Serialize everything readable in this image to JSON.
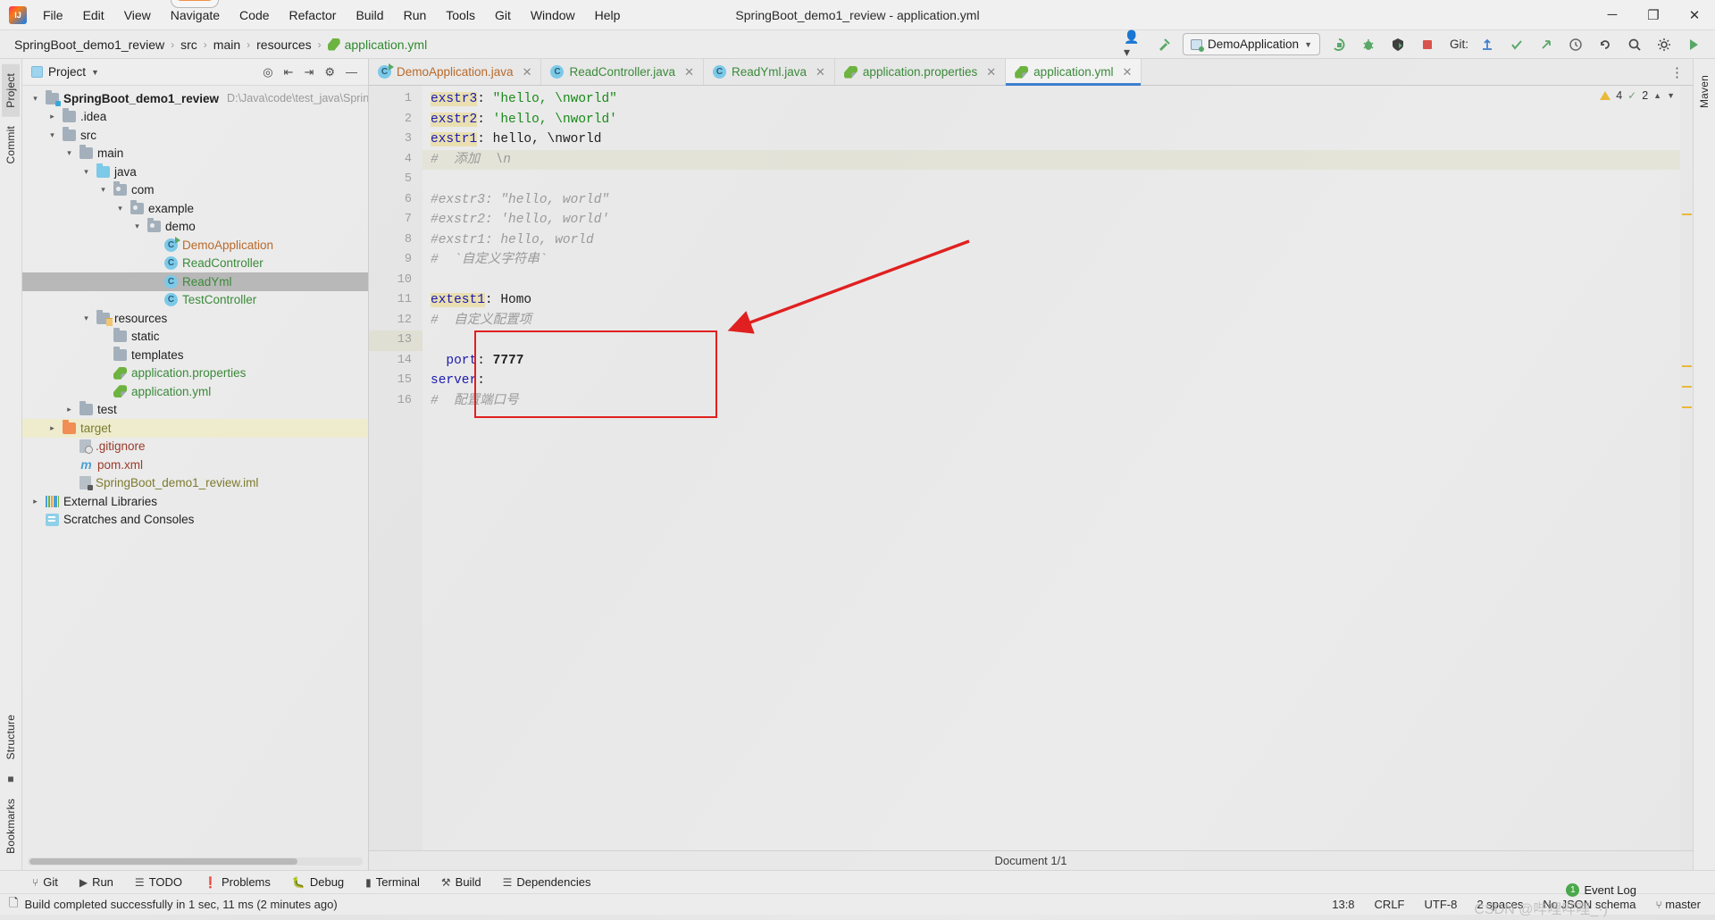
{
  "window": {
    "title": "SpringBoot_demo1_review - application.yml",
    "logo": "intellij-logo",
    "minimize": "─",
    "maximize": "❐",
    "close": "✕"
  },
  "menu": [
    {
      "label": "File"
    },
    {
      "label": "Edit"
    },
    {
      "label": "View"
    },
    {
      "label": "Navigate",
      "tooltip": true
    },
    {
      "label": "Code"
    },
    {
      "label": "Refactor"
    },
    {
      "label": "Build"
    },
    {
      "label": "Run"
    },
    {
      "label": "Tools"
    },
    {
      "label": "Git"
    },
    {
      "label": "Window"
    },
    {
      "label": "Help"
    }
  ],
  "navbar": {
    "crumbs": [
      "SpringBoot_demo1_review",
      "src",
      "main",
      "resources",
      "application.yml"
    ],
    "separator": "›",
    "run_config": "DemoApplication",
    "git_label": "Git:",
    "icons": {
      "profile": "user-icon",
      "build_hammer": "hammer-icon",
      "rerun": "rerun-icon",
      "debug": "debug-icon",
      "coverage": "coverage-icon",
      "stop": "stop-icon",
      "update": "git-update-icon",
      "commit": "git-commit-icon",
      "push": "git-push-icon",
      "history": "history-icon",
      "rollback": "rollback-icon",
      "search": "search-icon",
      "settings": "gear-icon",
      "run_green": "run-icon"
    }
  },
  "left_strip": {
    "tabs": [
      "Project",
      "Commit",
      "Structure",
      "Bookmarks"
    ]
  },
  "right_strip": {
    "tabs": [
      "Maven"
    ]
  },
  "project_panel": {
    "title": "Project",
    "actions": [
      "target-icon",
      "collapse-icon",
      "expand-icon",
      "gear-icon",
      "hide-icon"
    ],
    "tree": [
      {
        "depth": 0,
        "arrow": "⌄",
        "icon": "project-folder",
        "label": "SpringBoot_demo1_review",
        "bold": true,
        "path": "D:\\Java\\code\\test_java\\SpringBo",
        "state": "normal"
      },
      {
        "depth": 1,
        "arrow": "›",
        "icon": "folder",
        "label": ".idea",
        "state": "normal"
      },
      {
        "depth": 1,
        "arrow": "⌄",
        "icon": "folder",
        "label": "src",
        "state": "normal"
      },
      {
        "depth": 2,
        "arrow": "⌄",
        "icon": "folder",
        "label": "main",
        "state": "normal"
      },
      {
        "depth": 3,
        "arrow": "⌄",
        "icon": "source-folder",
        "label": "java",
        "state": "normal"
      },
      {
        "depth": 4,
        "arrow": "⌄",
        "icon": "package",
        "label": "com",
        "state": "normal"
      },
      {
        "depth": 5,
        "arrow": "⌄",
        "icon": "package",
        "label": "example",
        "state": "normal"
      },
      {
        "depth": 6,
        "arrow": "⌄",
        "icon": "package",
        "label": "demo",
        "state": "normal"
      },
      {
        "depth": 7,
        "arrow": "",
        "icon": "class-runnable",
        "label": "DemoApplication",
        "color": "orange",
        "state": "normal"
      },
      {
        "depth": 7,
        "arrow": "",
        "icon": "class",
        "label": "ReadController",
        "color": "green",
        "state": "normal"
      },
      {
        "depth": 7,
        "arrow": "",
        "icon": "class",
        "label": "ReadYml",
        "color": "green",
        "state": "selected"
      },
      {
        "depth": 7,
        "arrow": "",
        "icon": "class",
        "label": "TestController",
        "color": "green",
        "state": "normal"
      },
      {
        "depth": 3,
        "arrow": "⌄",
        "icon": "resources-folder",
        "label": "resources",
        "state": "normal"
      },
      {
        "depth": 4,
        "arrow": "",
        "icon": "folder",
        "label": "static",
        "state": "normal"
      },
      {
        "depth": 4,
        "arrow": "",
        "icon": "folder",
        "label": "templates",
        "state": "normal"
      },
      {
        "depth": 4,
        "arrow": "",
        "icon": "yml-file",
        "label": "application.properties",
        "color": "green",
        "state": "normal"
      },
      {
        "depth": 4,
        "arrow": "",
        "icon": "yml-file",
        "label": "application.yml",
        "color": "green",
        "state": "normal"
      },
      {
        "depth": 2,
        "arrow": "›",
        "icon": "folder",
        "label": "test",
        "state": "normal"
      },
      {
        "depth": 1,
        "arrow": "›",
        "icon": "target-folder",
        "label": "target",
        "color": "olive",
        "state": "highlight"
      },
      {
        "depth": 2,
        "arrow": "",
        "icon": "gitignore-file",
        "label": ".gitignore",
        "color": "red",
        "state": "normal"
      },
      {
        "depth": 2,
        "arrow": "",
        "icon": "maven-file",
        "label": "pom.xml",
        "color": "red",
        "state": "normal"
      },
      {
        "depth": 2,
        "arrow": "",
        "icon": "iml-file",
        "label": "SpringBoot_demo1_review.iml",
        "color": "olive",
        "state": "normal"
      },
      {
        "depth": 0,
        "arrow": "›",
        "icon": "library",
        "label": "External Libraries",
        "state": "normal"
      },
      {
        "depth": 0,
        "arrow": "",
        "icon": "scratch",
        "label": "Scratches and Consoles",
        "state": "normal"
      }
    ]
  },
  "editor": {
    "tabs": [
      {
        "label": "DemoApplication.java",
        "icon": "class-runnable",
        "color": "orange",
        "active": false,
        "close": "✕"
      },
      {
        "label": "ReadController.java",
        "icon": "class",
        "color": "green",
        "active": false,
        "close": "✕"
      },
      {
        "label": "ReadYml.java",
        "icon": "class",
        "color": "green",
        "active": false,
        "close": "✕"
      },
      {
        "label": "application.properties",
        "icon": "yml-file",
        "color": "green",
        "active": false,
        "close": "✕"
      },
      {
        "label": "application.yml",
        "icon": "yml-file",
        "color": "green",
        "active": true,
        "close": "✕"
      }
    ],
    "more_icon": "⋮",
    "inspection": {
      "warnings": "4",
      "weak_warnings": "2",
      "up_icon": "⌃",
      "down_icon": "⌄"
    },
    "lines": [
      {
        "n": "1",
        "tokens": [
          {
            "t": "#  配置端口号",
            "c": "cmt"
          }
        ]
      },
      {
        "n": "2",
        "tokens": [
          {
            "t": "server",
            "c": "key"
          },
          {
            "t": ":",
            "c": "val"
          }
        ],
        "fold": "minus"
      },
      {
        "n": "3",
        "tokens": [
          {
            "t": "  port",
            "c": "key"
          },
          {
            "t": ": ",
            "c": "val"
          },
          {
            "t": "7777",
            "c": "num"
          }
        ],
        "fold": "end"
      },
      {
        "n": "4",
        "tokens": []
      },
      {
        "n": "5",
        "tokens": [
          {
            "t": "#  自定义配置项",
            "c": "cmt"
          }
        ]
      },
      {
        "n": "6",
        "tokens": [
          {
            "t": "extest1",
            "c": "key hl"
          },
          {
            "t": ": ",
            "c": "val"
          },
          {
            "t": "Homo",
            "c": "val"
          }
        ]
      },
      {
        "n": "7",
        "tokens": []
      },
      {
        "n": "8",
        "tokens": [
          {
            "t": "#  `自定义字符串`",
            "c": "cmt"
          }
        ]
      },
      {
        "n": "9",
        "tokens": [
          {
            "t": "#exstr1: hello, world",
            "c": "cmt"
          }
        ]
      },
      {
        "n": "10",
        "tokens": [
          {
            "t": "#exstr2: 'hello, world'",
            "c": "cmt"
          }
        ]
      },
      {
        "n": "11",
        "tokens": [
          {
            "t": "#exstr3: \"hello, world\"",
            "c": "cmt"
          }
        ]
      },
      {
        "n": "12",
        "tokens": []
      },
      {
        "n": "13",
        "tokens": [
          {
            "t": "#  添加  \\n",
            "c": "cmt"
          }
        ],
        "current": true
      },
      {
        "n": "14",
        "tokens": [
          {
            "t": "exstr1",
            "c": "key hl"
          },
          {
            "t": ": ",
            "c": "val"
          },
          {
            "t": "hello, \\nworld",
            "c": "val"
          }
        ]
      },
      {
        "n": "15",
        "tokens": [
          {
            "t": "exstr2",
            "c": "key hl"
          },
          {
            "t": ": ",
            "c": "val"
          },
          {
            "t": "'hello, \\nworld'",
            "c": "str"
          }
        ]
      },
      {
        "n": "16",
        "tokens": [
          {
            "t": "exstr3",
            "c": "key hl"
          },
          {
            "t": ": ",
            "c": "val"
          },
          {
            "t": "\"hello, \\nworld\"",
            "c": "str"
          }
        ]
      }
    ],
    "annotation": {
      "box_color": "#e02020",
      "arrow_color": "#e02020"
    },
    "document_status": "Document 1/1"
  },
  "tool_windows": [
    {
      "label": "Git",
      "icon": "git-branch-icon"
    },
    {
      "label": "Run",
      "icon": "run-icon"
    },
    {
      "label": "TODO",
      "icon": "todo-icon"
    },
    {
      "label": "Problems",
      "icon": "problems-icon"
    },
    {
      "label": "Debug",
      "icon": "debug-icon"
    },
    {
      "label": "Terminal",
      "icon": "terminal-icon"
    },
    {
      "label": "Build",
      "icon": "build-icon"
    },
    {
      "label": "Dependencies",
      "icon": "dependencies-icon"
    }
  ],
  "status_bar": {
    "message": "Build completed successfully in 1 sec, 11 ms (2 minutes ago)",
    "message_icon": "document-icon",
    "caret": "13:8",
    "line_sep": "CRLF",
    "encoding": "UTF-8",
    "indent": "2 spaces",
    "schema": "No JSON schema",
    "branch": "master",
    "branch_icon": "git-branch-icon",
    "event_log": "Event Log",
    "event_count": "1",
    "watermark": "CSDN @哔哩哔哩_·)"
  }
}
